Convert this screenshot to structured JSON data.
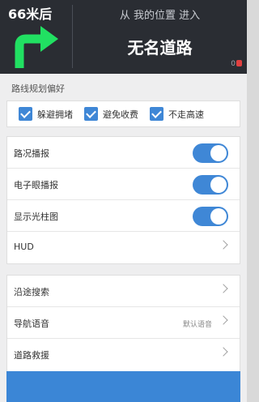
{
  "nav": {
    "distance": "66米后",
    "route_from": "从 我的位置 进入",
    "road_name": "无名道路",
    "status_count": "0",
    "icons": {
      "turn": "turn-right-arrow-icon",
      "pin": "location-pin-icon"
    },
    "colors": {
      "arrow": "#21e062",
      "background": "#2a2d33"
    }
  },
  "settings": {
    "section_title": "路线规划偏好",
    "preferences": [
      {
        "label": "躲避拥堵",
        "checked": true
      },
      {
        "label": "避免收费",
        "checked": true
      },
      {
        "label": "不走高速",
        "checked": true
      }
    ],
    "toggles": [
      {
        "label": "路况播报",
        "on": true
      },
      {
        "label": "电子眼播报",
        "on": true
      },
      {
        "label": "显示光柱图",
        "on": true
      }
    ],
    "hud_label": "HUD",
    "more": [
      {
        "label": "沿途搜索",
        "value": ""
      },
      {
        "label": "导航语音",
        "value": "默认语音"
      },
      {
        "label": "道路救援",
        "value": ""
      }
    ],
    "accent_color": "#3f87d6"
  }
}
